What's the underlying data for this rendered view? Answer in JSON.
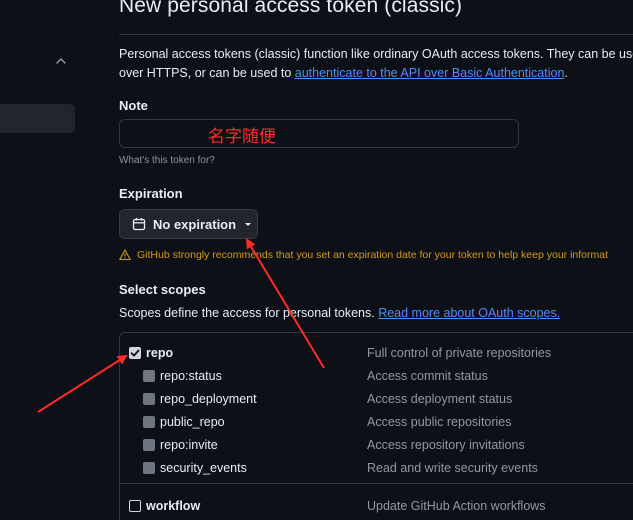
{
  "page": {
    "title": "New personal access token (classic)",
    "intro_line1": "Personal access tokens (classic) function like ordinary OAuth access tokens. They can be use",
    "intro_line2_prefix": "over HTTPS, or can be used to ",
    "intro_link": "authenticate to the API over Basic Authentication",
    "intro_line2_suffix": "."
  },
  "note": {
    "label": "Note",
    "value": "",
    "annotation": "名字随便",
    "hint": "What's this token for?"
  },
  "expiration": {
    "label": "Expiration",
    "selected": "No expiration",
    "warning": "GitHub strongly recommends that you set an expiration date for your token to help keep your informat"
  },
  "scopes": {
    "label": "Select scopes",
    "description_prefix": "Scopes define the access for personal tokens. ",
    "description_link": "Read more about OAuth scopes.",
    "items": [
      {
        "name": "repo",
        "description": "Full control of private repositories",
        "checked": true
      },
      {
        "name": "repo:status",
        "description": "Access commit status",
        "checked": true
      },
      {
        "name": "repo_deployment",
        "description": "Access deployment status",
        "checked": true
      },
      {
        "name": "public_repo",
        "description": "Access public repositories",
        "checked": true
      },
      {
        "name": "repo:invite",
        "description": "Access repository invitations",
        "checked": true
      },
      {
        "name": "security_events",
        "description": "Read and write security events",
        "checked": true
      },
      {
        "name": "workflow",
        "description": "Update GitHub Action workflows",
        "checked": false
      }
    ]
  },
  "colors": {
    "background": "#0d1117",
    "link": "#4493f8",
    "warning": "#d29922",
    "annotation": "#ff2a2a"
  },
  "icons": {
    "sidebar_toggle": "chevron-up-icon",
    "calendar": "calendar-icon",
    "caret": "caret-down-icon",
    "warning": "alert-icon"
  }
}
